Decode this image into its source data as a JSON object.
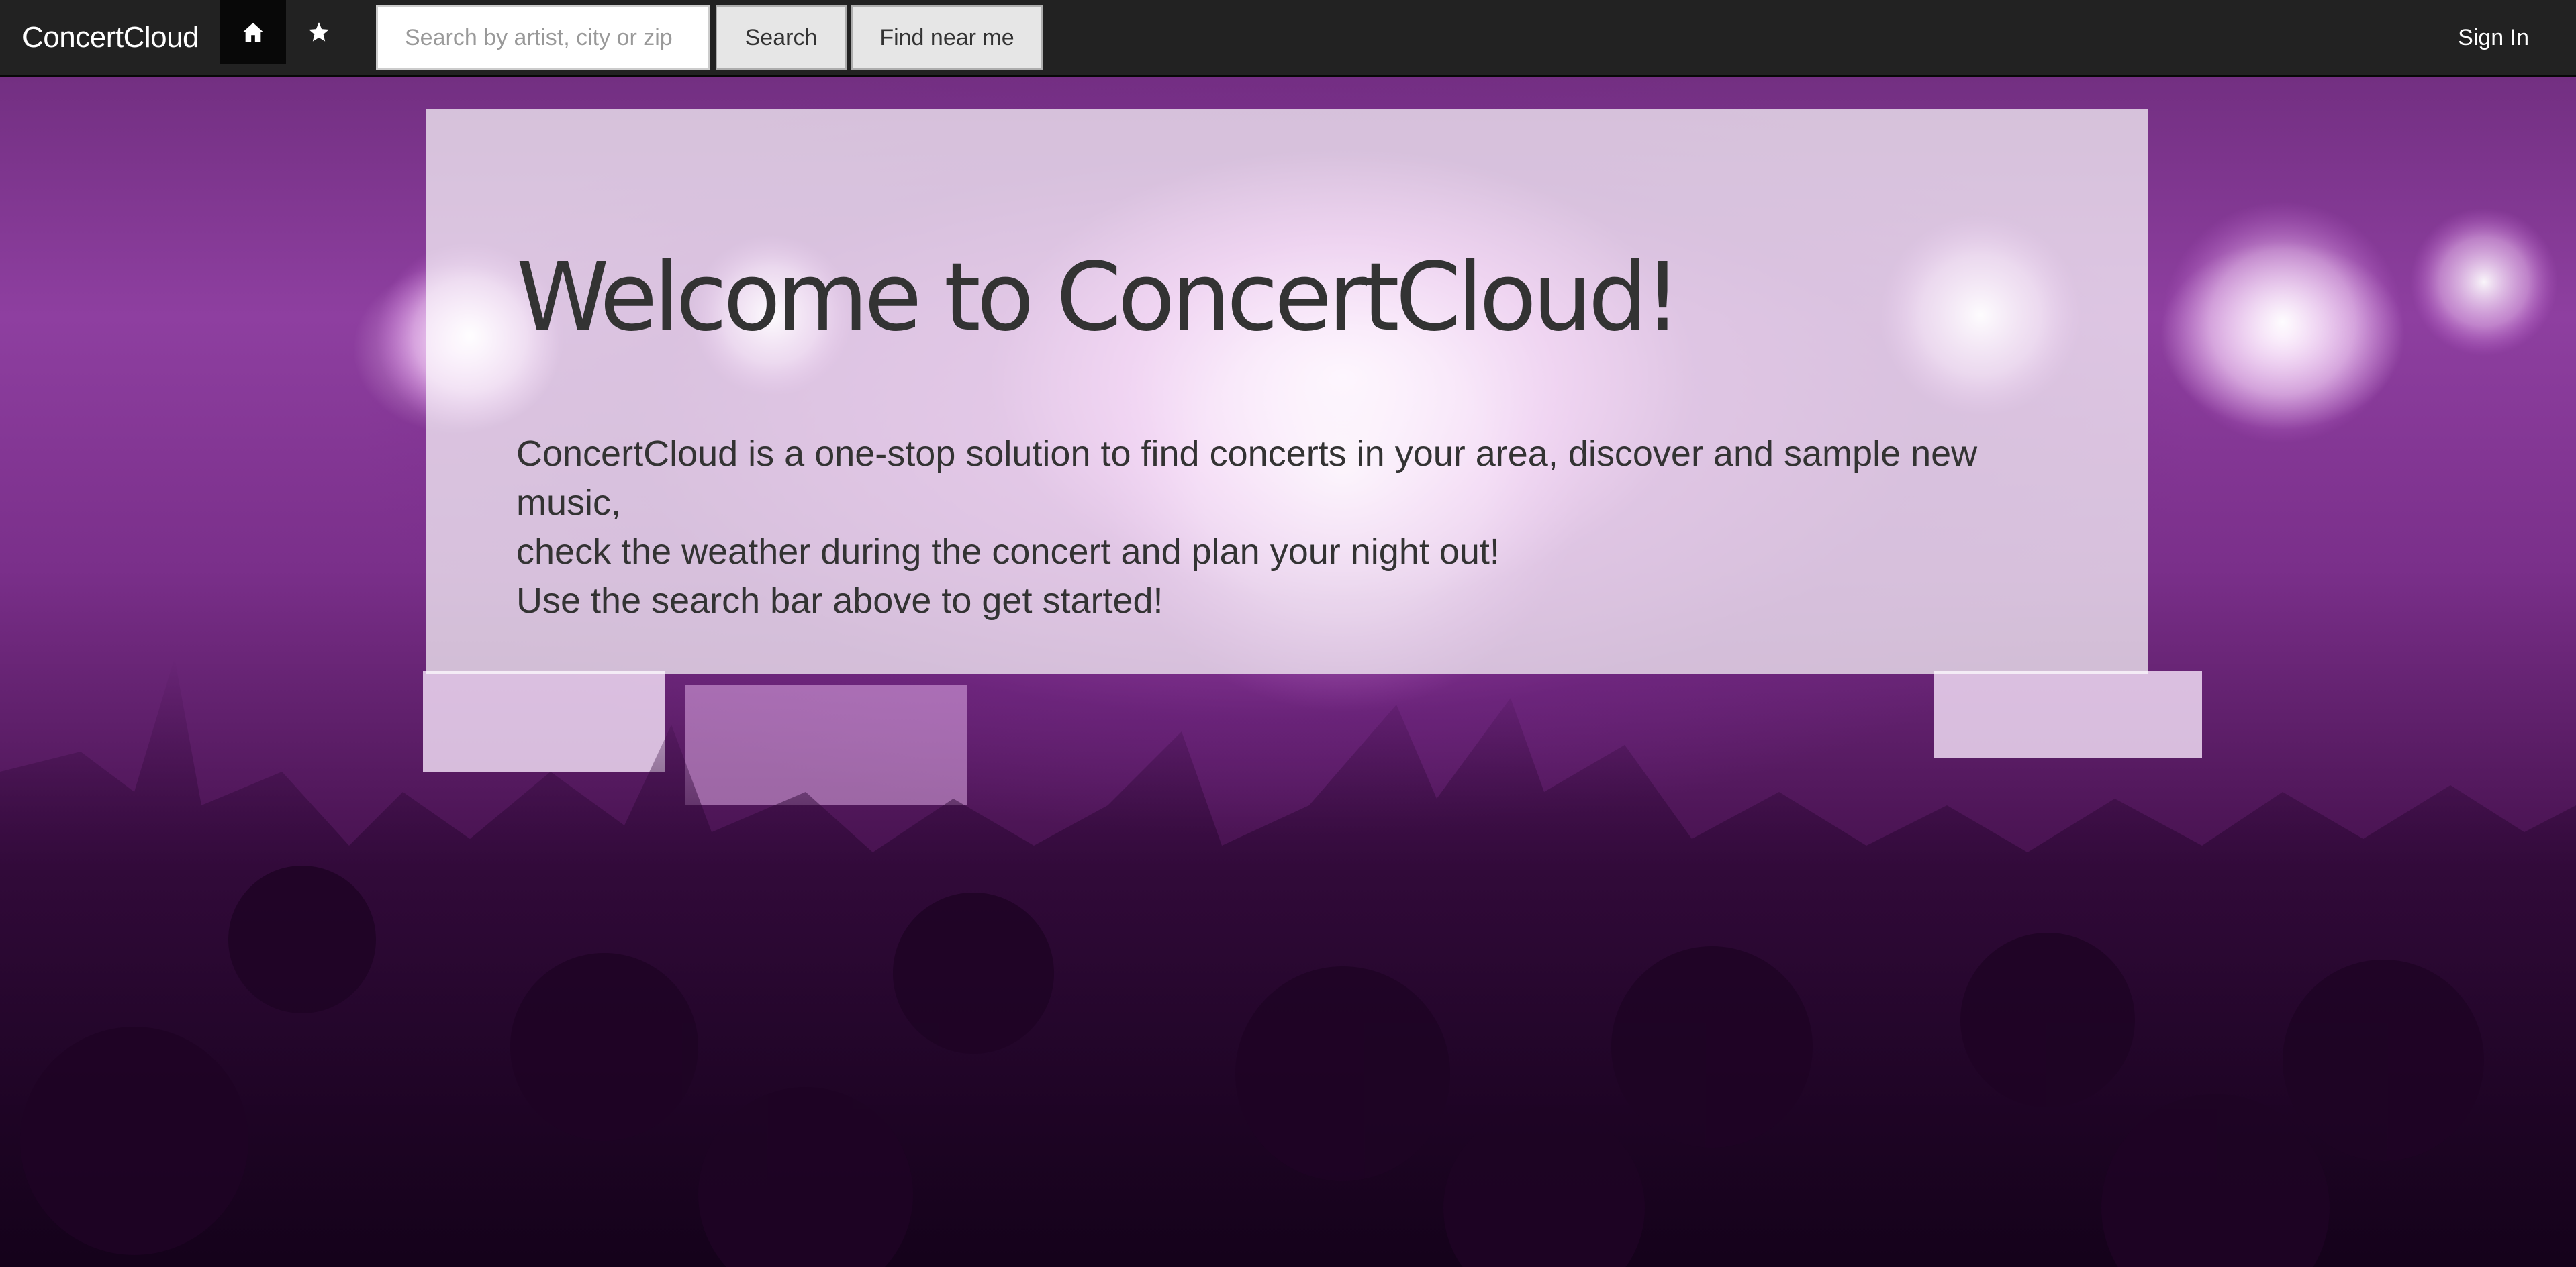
{
  "app": {
    "brand": "ConcertCloud"
  },
  "navbar": {
    "home_icon": "home-icon",
    "favorites_icon": "star-icon",
    "search": {
      "placeholder": "Search by artist, city or zip",
      "value": ""
    },
    "search_button_label": "Search",
    "find_near_me_label": "Find near me",
    "sign_in_label": "Sign In",
    "background_color": "#222222",
    "active_item_color": "#080808"
  },
  "hero": {
    "title": "Welcome to ConcertCloud!",
    "description_lines": [
      "ConcertCloud is a one-stop solution to find concerts in your area, discover and sample new music,",
      "check the weather during the concert and plan your night out!",
      "Use the search bar above to get started!"
    ],
    "background_image": "concert-crowd-photo"
  },
  "colors": {
    "text_dark": "#333333",
    "button_bg": "#e6e6e6",
    "button_border": "#adadad",
    "hero_tint": "#8e3fa0"
  }
}
